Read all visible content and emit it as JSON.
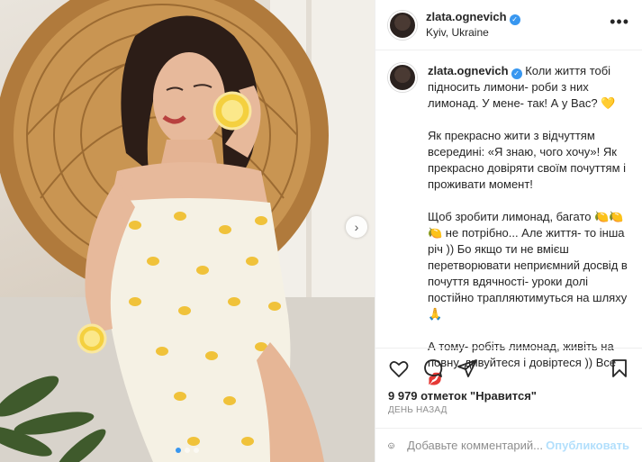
{
  "post": {
    "username": "zlata.ognevich",
    "verified_mark": "✓",
    "location": "Kyiv, Ukraine",
    "more_label": "•••",
    "caption": {
      "p1": "Коли життя тобі підносить лимони- роби з них лимонад. У мене- так! А у Вас? 💛",
      "p2": "Як прекрасно жити з відчуттям всередині: «Я знаю, чого хочу»! Як прекрасно довіряти своїм почуттям і проживати момент!",
      "p3": "Щоб зробити лимонад, багато 🍋🍋🍋 не потрібно... Але життя- то інша річ )) Бо якщо ти не вмієш перетворювати неприємний досвід в почуття вдячності- уроки долі постійно трапляютимуться на шляху 🙏",
      "p4": "А тому- робіть лимонад, живіть на повну, дивуйтеся і довіртеся )) Все💋"
    },
    "likes_text": "9 979 отметок \"Нравится\"",
    "time_text": "ДЕНЬ НАЗАД",
    "comment_placeholder": "Добавьте комментарий...",
    "publish_label": "Опубликовать",
    "next_arrow": "›",
    "carousel": {
      "count": 3,
      "active": 0
    }
  },
  "icons": [
    "heart-icon",
    "comment-icon",
    "share-icon",
    "bookmark-icon",
    "smiley-icon",
    "more-icon",
    "verified-icon",
    "next-arrow-icon"
  ],
  "colors": {
    "accent": "#3897f0",
    "publish_disabled": "#b2dffc",
    "muted": "#8e8e8e",
    "border": "#efefef"
  }
}
